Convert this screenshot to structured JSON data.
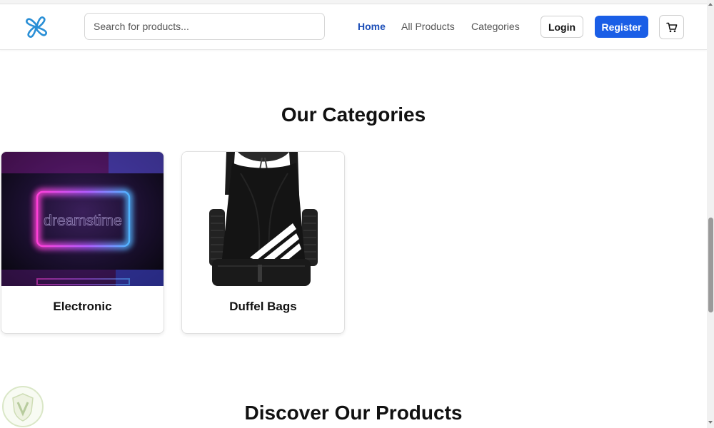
{
  "header": {
    "logo_icon": "propeller-logo-icon",
    "search": {
      "placeholder": "Search for products...",
      "value": ""
    },
    "nav": [
      {
        "label": "Home",
        "active": true
      },
      {
        "label": "All Products",
        "active": false
      },
      {
        "label": "Categories",
        "active": false
      }
    ],
    "login_label": "Login",
    "register_label": "Register",
    "cart_icon": "cart-icon"
  },
  "categories_section": {
    "title": "Our Categories",
    "items": [
      {
        "label": "Electronic",
        "image": "neon-frame-image",
        "image_watermark": "dreamstime"
      },
      {
        "label": "Duffel Bags",
        "image": "drawstring-backpack-image"
      }
    ]
  },
  "products_section": {
    "title": "Discover Our Products"
  },
  "colors": {
    "accent": "#1a5ee6",
    "active_link": "#1d4fb8",
    "text": "#111111"
  }
}
